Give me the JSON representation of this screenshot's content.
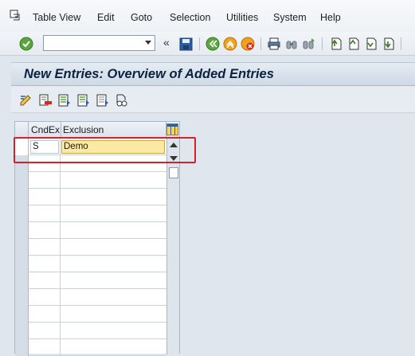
{
  "menu": {
    "items": [
      "Table View",
      "Edit",
      "Goto",
      "Selection",
      "Utilities",
      "System",
      "Help"
    ]
  },
  "toolbar": {
    "command_value": "",
    "icons": [
      "enter-icon",
      "save-icon",
      "back-icon",
      "exit-icon",
      "cancel-icon",
      "print-icon",
      "find-icon",
      "find-next-icon",
      "first-page-icon",
      "previous-page-icon",
      "next-page-icon",
      "last-page-icon"
    ]
  },
  "title": "New Entries: Overview of Added Entries",
  "app_toolbar": {
    "icons": [
      "change-display-icon",
      "delete-icon",
      "select-all-icon",
      "select-block-icon",
      "deselect-all-icon",
      "variables-icon"
    ]
  },
  "table": {
    "columns": [
      "CndEx",
      "Exclusion"
    ],
    "rows": [
      {
        "cndex": "S",
        "exclusion": "Demo"
      }
    ],
    "empty_rows": 12
  },
  "colors": {
    "accent": "#0c2240",
    "highlight_border": "#d0232b",
    "input_highlight": "#fce9a4"
  }
}
